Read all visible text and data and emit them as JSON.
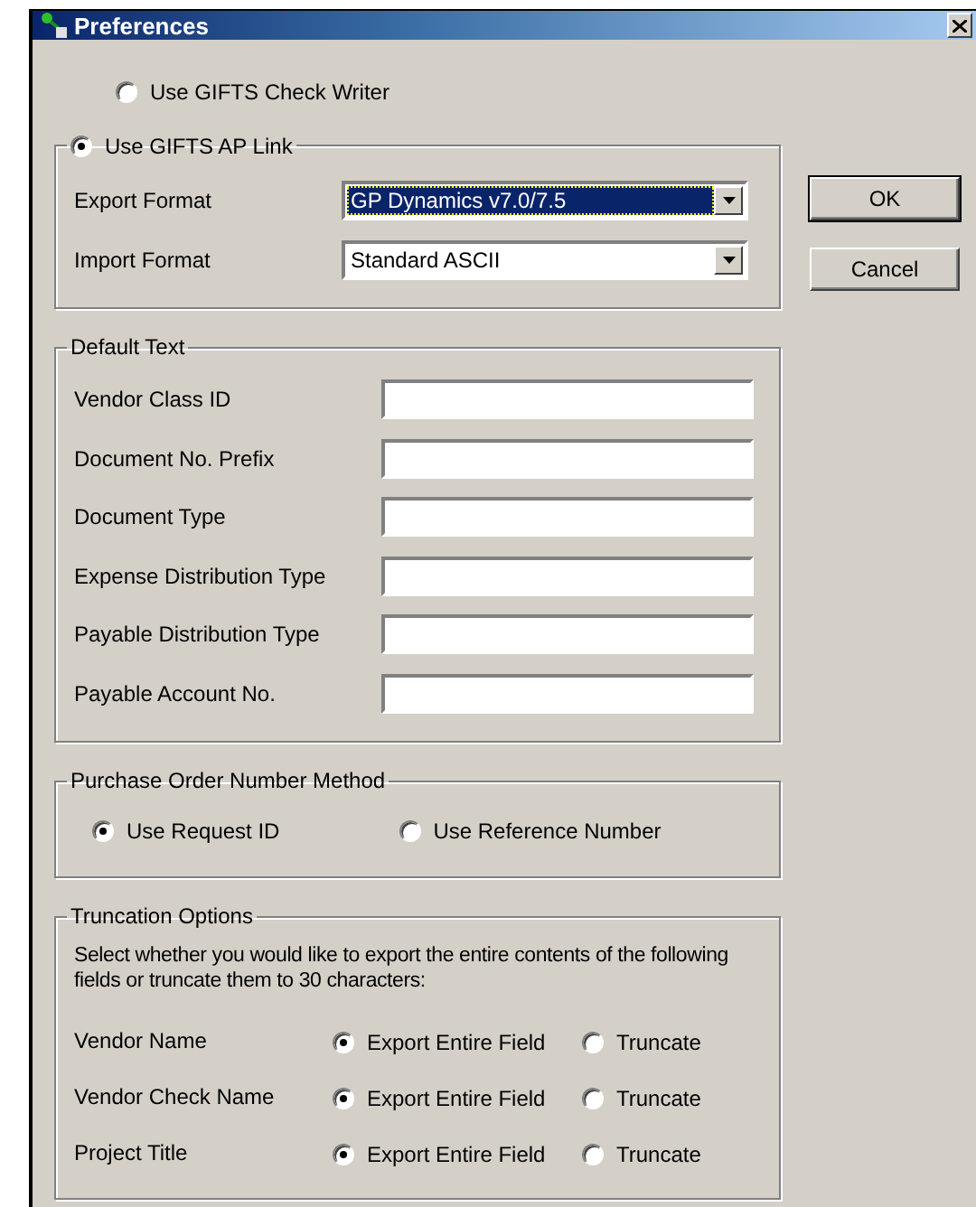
{
  "window": {
    "title": "Preferences"
  },
  "mode_options": [
    {
      "label": "Use GIFTS Check Writer",
      "selected": false
    },
    {
      "label": "Use GIFTS AP Link",
      "selected": true
    }
  ],
  "ap_link": {
    "fields": [
      {
        "label": "Export Format",
        "value": "GP Dynamics v7.0/7.5",
        "focused": true
      },
      {
        "label": "Import Format",
        "value": "Standard ASCII",
        "focused": false
      }
    ]
  },
  "default_text": {
    "title": "Default Text",
    "fields": [
      {
        "label": "Vendor Class ID"
      },
      {
        "label": "Document No. Prefix"
      },
      {
        "label": "Document Type"
      },
      {
        "label": "Expense Distribution Type"
      },
      {
        "label": "Payable Distribution Type"
      },
      {
        "label": "Payable Account No."
      }
    ]
  },
  "po_method": {
    "title": "Purchase Order Number Method",
    "options": [
      {
        "label": "Use Request ID",
        "selected": true
      },
      {
        "label": "Use Reference Number",
        "selected": false
      }
    ]
  },
  "truncation": {
    "title": "Truncation Options",
    "description": "Select whether you would like to export the entire contents of the following fields or truncate them to 30 characters:",
    "rows": [
      {
        "label": "Vendor Name",
        "options": [
          {
            "label": "Export Entire Field",
            "selected": true
          },
          {
            "label": "Truncate",
            "selected": false
          }
        ]
      },
      {
        "label": "Vendor Check Name",
        "options": [
          {
            "label": "Export Entire Field",
            "selected": true
          },
          {
            "label": "Truncate",
            "selected": false
          }
        ]
      },
      {
        "label": "Project Title",
        "options": [
          {
            "label": "Export Entire Field",
            "selected": true
          },
          {
            "label": "Truncate",
            "selected": false
          }
        ]
      }
    ]
  },
  "buttons": [
    "OK",
    "Cancel"
  ]
}
